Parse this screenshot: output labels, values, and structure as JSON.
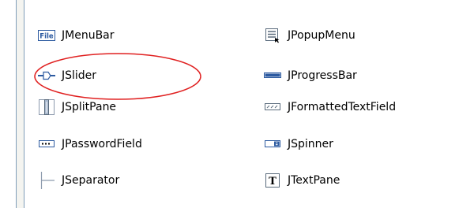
{
  "palette": {
    "items": [
      {
        "label": "JMenuBar",
        "icon": "menubar-icon"
      },
      {
        "label": "JPopupMenu",
        "icon": "popupmenu-icon"
      },
      {
        "label": "JSlider",
        "icon": "slider-icon"
      },
      {
        "label": "JProgressBar",
        "icon": "progressbar-icon"
      },
      {
        "label": "JSplitPane",
        "icon": "splitpane-icon"
      },
      {
        "label": "JFormattedTextField",
        "icon": "formattedtextfield-icon"
      },
      {
        "label": "JPasswordField",
        "icon": "passwordfield-icon"
      },
      {
        "label": "JSpinner",
        "icon": "spinner-icon"
      },
      {
        "label": "JSeparator",
        "icon": "separator-icon"
      },
      {
        "label": "JTextPane",
        "icon": "textpane-icon"
      }
    ],
    "menubar_icon_text": "File",
    "textpane_icon_text": "T"
  },
  "annotation": {
    "color": "#e02020",
    "shape": "ellipse around JSlider"
  },
  "colors": {
    "border": "#7f9db9",
    "icon_blue": "#2c5aa0",
    "icon_gray": "#5a6b7c"
  }
}
